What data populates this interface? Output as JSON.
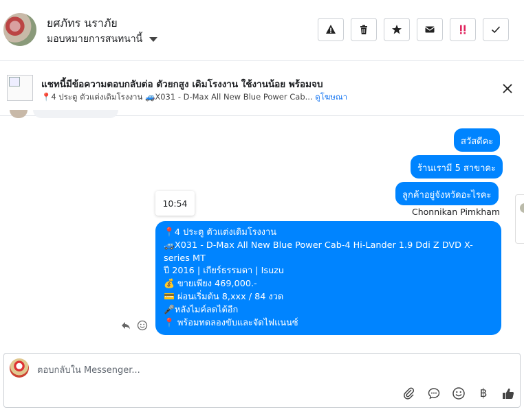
{
  "header": {
    "user_name": "ยศภัทร นราภัย",
    "assign_label": "มอบหมายการสนทนานี้",
    "actions": [
      {
        "icon": "warning-icon"
      },
      {
        "icon": "trash-icon"
      },
      {
        "icon": "star-icon"
      },
      {
        "icon": "envelope-icon"
      },
      {
        "icon": "double-exclamation-icon",
        "color": "#e0245e"
      },
      {
        "icon": "check-icon"
      }
    ]
  },
  "ad": {
    "title": "แชทนี้มีข้อความตอบกลับต่อ ตัวยกสูง เดิมโรงงาน ใช้งานน้อย พร้อมจบ",
    "subtitle": "📍4 ประตู ตัวแต่งเดิมโรงงาน 🚙X031 - D-Max All New Blue Power Cab...",
    "link": "ดูโฆษณา"
  },
  "messages": {
    "m1": "สวัสดีคะ",
    "m2": "ร้านเรามี 5 สาขาคะ",
    "m3": "ลูกค้าอยู่จังหวัดอะไรคะ",
    "sender": "Chonnikan Pimkham",
    "time": "10:54",
    "long_lines": [
      "📍4 ประตู ตัวแต่งเดิมโรงงาน",
      "🚙X031 - D-Max All New Blue Power Cab-4 Hi-Lander 1.9 Ddi Z DVD X-series MT",
      "ปี 2016 | เกียร์ธรรมดา | Isuzu",
      "💰 ขายเพียง 469,000.-",
      "💳 ผ่อนเริ่มต้น 8,xxx / 84 งวด",
      "🎤หลังไมค์ลดได้อีก",
      "📍 พร้อมทดลองขับและจัดไฟแนนซ์"
    ]
  },
  "composer": {
    "placeholder": "ตอบกลับใน Messenger...",
    "currency_symbol": "฿"
  },
  "colors": {
    "bubble_blue": "#0084ff",
    "link_blue": "#1877f2",
    "alert_red": "#e0245e"
  }
}
